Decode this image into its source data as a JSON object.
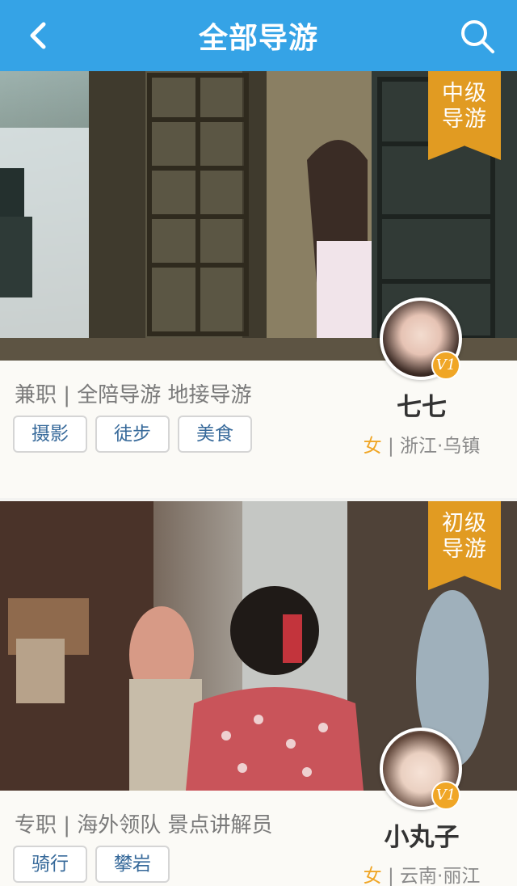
{
  "header": {
    "title": "全部导游"
  },
  "guides": [
    {
      "level": [
        "中级",
        "导游"
      ],
      "tagline": "兼职 | 全陪导游 地接导游",
      "tags": [
        "摄影",
        "徒步",
        "美食"
      ],
      "name": "七七",
      "gender": "女",
      "separator": " | ",
      "location": "浙江·乌镇",
      "vip_label": "V1"
    },
    {
      "level": [
        "初级",
        "导游"
      ],
      "tagline": "专职 | 海外领队 景点讲解员",
      "tags": [
        "骑行",
        "攀岩"
      ],
      "name": "小丸子",
      "gender": "女",
      "separator": " | ",
      "location": "云南·丽江",
      "vip_label": "V1"
    }
  ],
  "colors": {
    "header_bg": "#35a3e6",
    "badge_bg": "#e19b22",
    "chip_text": "#36699a",
    "gender_accent": "#f0a626"
  },
  "icons": {
    "back": "chevron-left-icon",
    "search": "search-icon"
  }
}
